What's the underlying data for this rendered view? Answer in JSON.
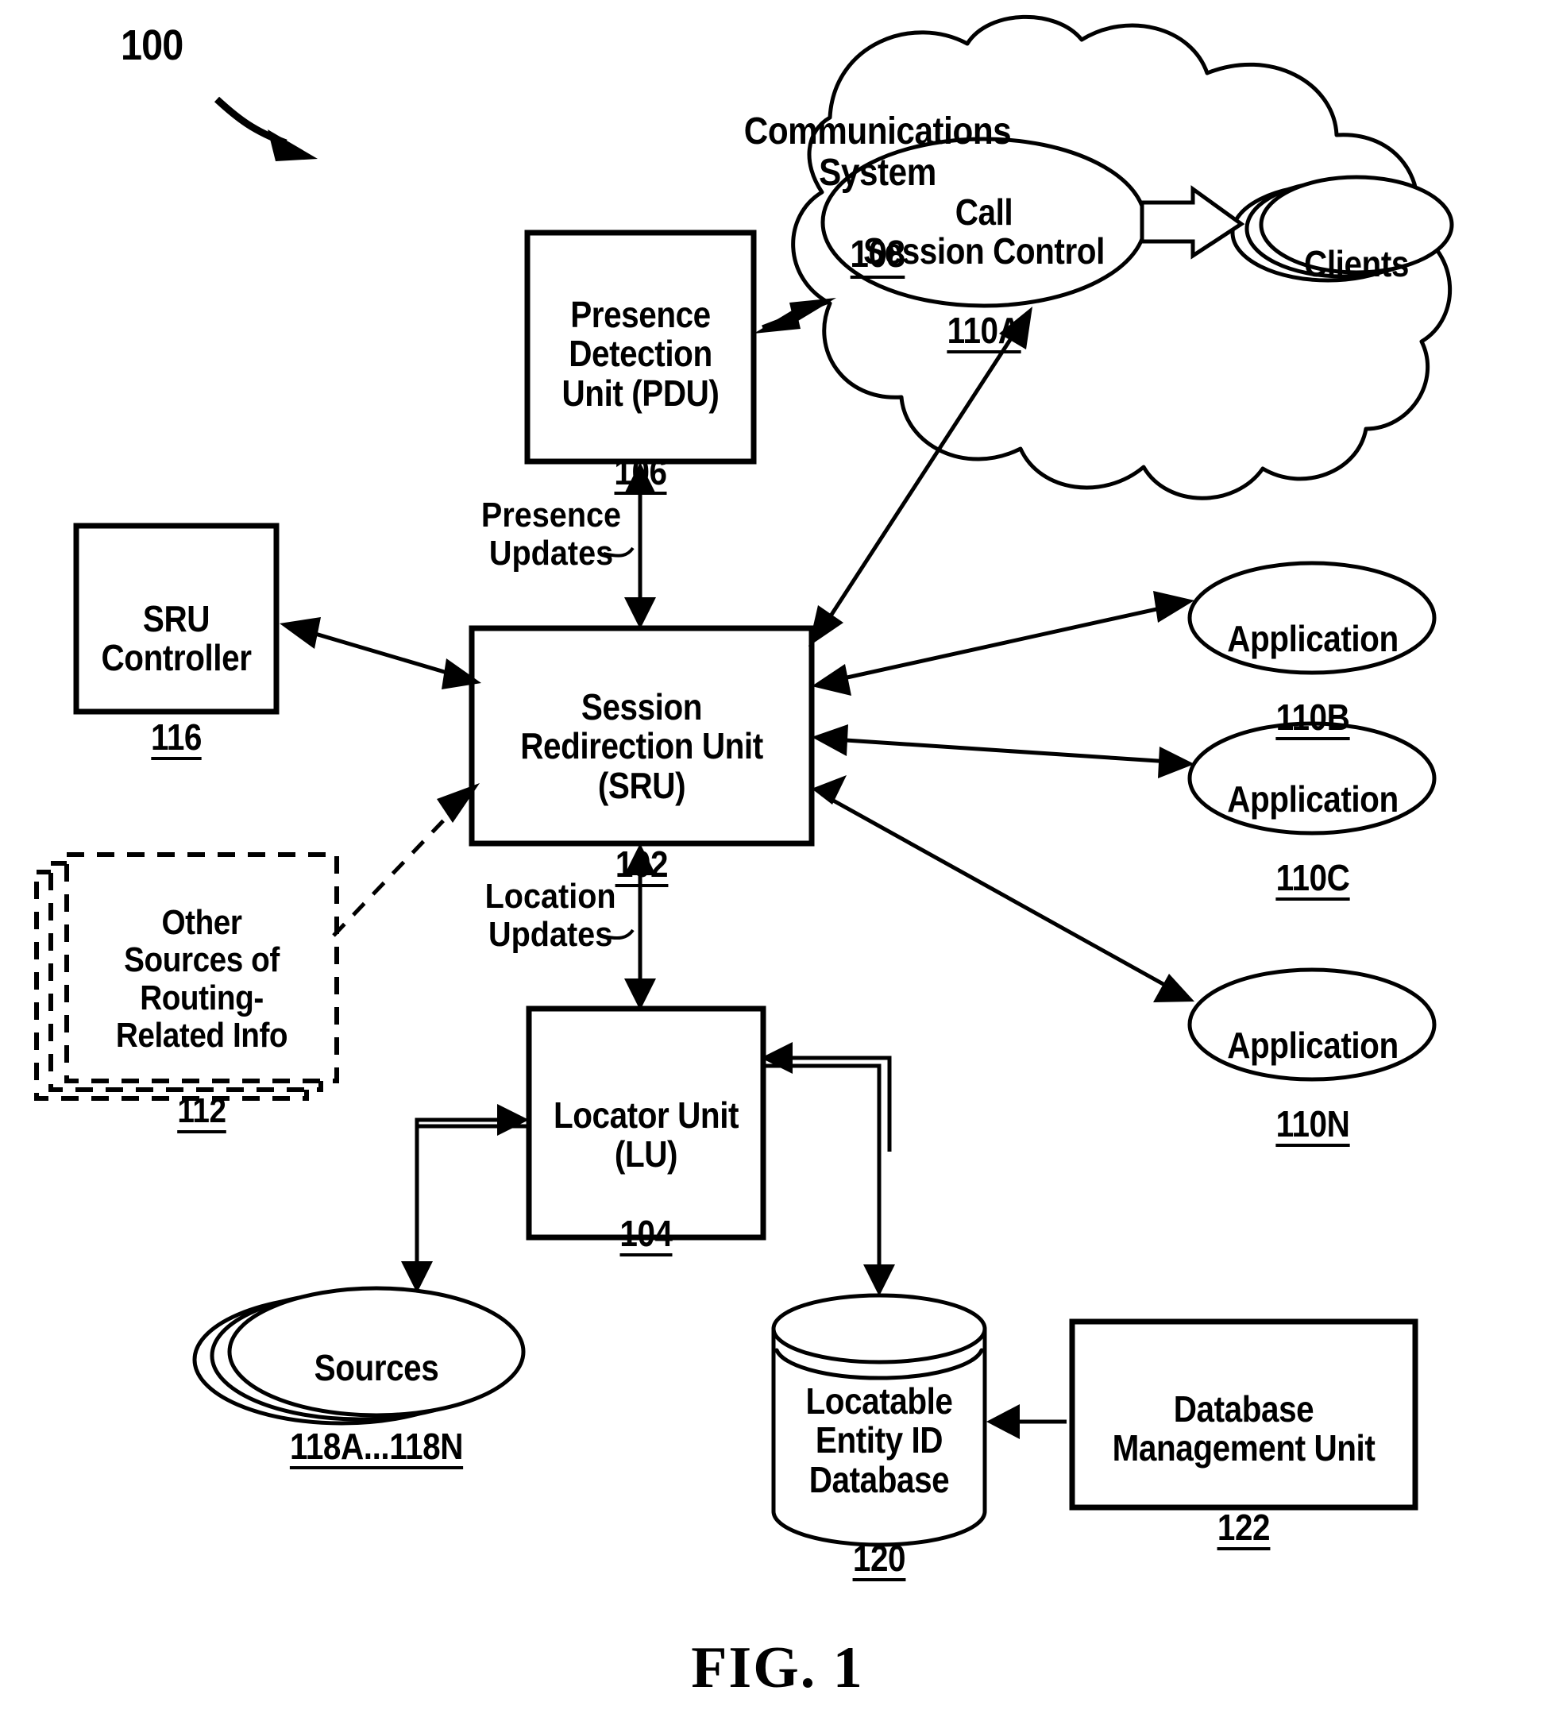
{
  "figure": {
    "caption": "FIG. 1",
    "system_ref": "100"
  },
  "nodes": {
    "presence_detection_unit": {
      "title": "Presence\nDetection\nUnit (PDU)",
      "ref": "106",
      "shape": "rectangle"
    },
    "communications_system": {
      "title": "Communications System",
      "ref": "108",
      "shape": "cloud"
    },
    "call_session_control": {
      "title": "Call\nSession Control",
      "ref": "110A",
      "shape": "ellipse"
    },
    "clients": {
      "title": "Clients",
      "ref": "",
      "shape": "ellipse-stack"
    },
    "sru_controller": {
      "title": "SRU\nController",
      "ref": "116",
      "shape": "rectangle"
    },
    "session_redirection_unit": {
      "title": "Session\nRedirection Unit\n(SRU)",
      "ref": "102",
      "shape": "rectangle"
    },
    "other_sources": {
      "title": "Other\nSources of\nRouting-\nRelated Info",
      "ref": "112",
      "shape": "dashed-rectangle-stack"
    },
    "application_b": {
      "title": "Application",
      "ref": "110B",
      "shape": "ellipse"
    },
    "application_c": {
      "title": "Application",
      "ref": "110C",
      "shape": "ellipse"
    },
    "application_n": {
      "title": "Application",
      "ref": "110N",
      "shape": "ellipse"
    },
    "locator_unit": {
      "title": "Locator Unit\n(LU)",
      "ref": "104",
      "shape": "rectangle"
    },
    "sources": {
      "title": "Sources",
      "ref": "118A...118N",
      "shape": "ellipse-stack"
    },
    "locatable_entity_db": {
      "title": "Locatable\nEntity ID\nDatabase",
      "ref": "120",
      "shape": "cylinder"
    },
    "database_management_unit": {
      "title": "Database\nManagement Unit",
      "ref": "122",
      "shape": "rectangle"
    }
  },
  "edge_labels": {
    "presence_updates": "Presence\nUpdates",
    "location_updates": "Location\nUpdates"
  },
  "colors": {
    "ink": "#000000",
    "paper": "#ffffff"
  }
}
